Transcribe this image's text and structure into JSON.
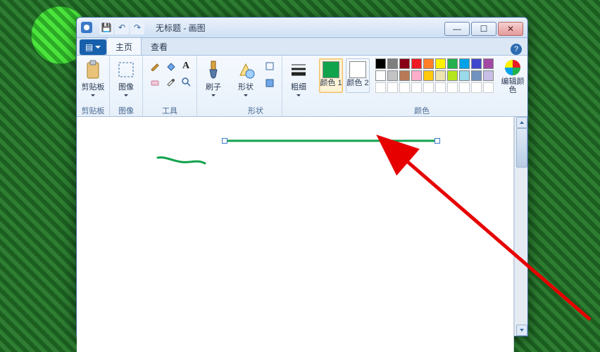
{
  "window": {
    "title": "无标题 - 画图"
  },
  "qat": {
    "save": "💾",
    "undo": "↶",
    "redo": "↷"
  },
  "win_controls": {
    "min": "—",
    "max": "☐",
    "close": "✕"
  },
  "tabs": {
    "file": "▤",
    "home": "主页",
    "view": "查看",
    "help": "?"
  },
  "ribbon": {
    "clipboard": {
      "label": "剪贴板",
      "big": "剪贴板"
    },
    "image": {
      "label": "图像",
      "big": "图像"
    },
    "tools": {
      "label": "工具"
    },
    "brush": {
      "big": "刷子"
    },
    "shapes": {
      "label": "形状",
      "big": "形状"
    },
    "size": {
      "big": "粗细"
    },
    "colors": {
      "label": "颜色",
      "c1": "颜色 1",
      "c2": "颜色 2",
      "edit": "编辑颜色",
      "c1_hex": "#11a24c",
      "c2_hex": "#ffffff",
      "row1": [
        "#000000",
        "#7f7f7f",
        "#880015",
        "#ed1c24",
        "#ff7f27",
        "#fff200",
        "#22b14c",
        "#00a2e8",
        "#3f48cc",
        "#a349a4"
      ],
      "row2": [
        "#ffffff",
        "#c3c3c3",
        "#b97a57",
        "#ffaec9",
        "#ffc90e",
        "#efe4b0",
        "#b5e61d",
        "#99d9ea",
        "#7092be",
        "#c8bfe7"
      ]
    }
  }
}
